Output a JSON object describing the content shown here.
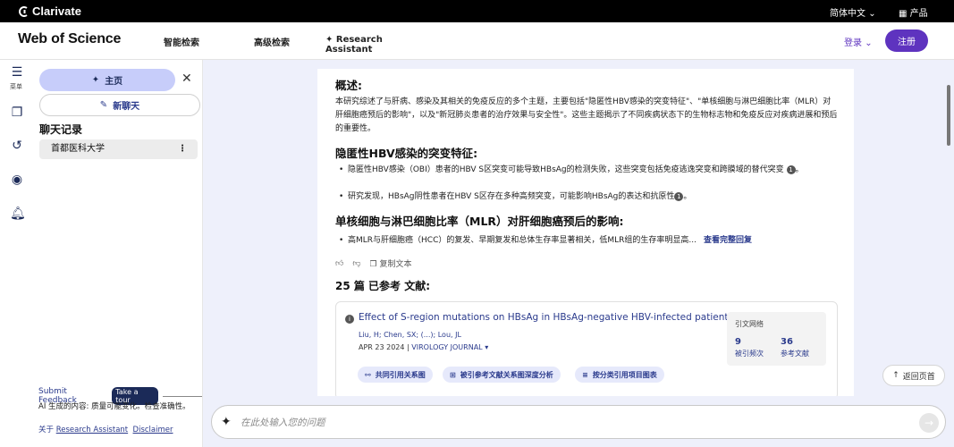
{
  "topbar": {
    "brand": "Clarivate",
    "language": "简体中文",
    "products": "产品"
  },
  "header": {
    "logo": "Web of Science",
    "nav": [
      "智能检索",
      "高级检索",
      "Research Assistant"
    ],
    "login": "登录",
    "register": "注册"
  },
  "rail": {
    "menu_label": "菜单"
  },
  "sidebar": {
    "home": "主页",
    "new_chat": "新聊天",
    "history_title": "聊天记录",
    "history_items": [
      "首都医科大学"
    ],
    "feedback": "Submit Feedback",
    "tour": "Take a tour",
    "ai_note": "AI 生成的内容: 质量可能变化。检查准确性。",
    "about_prefix": "关于 ",
    "about_link": "Research Assistant",
    "disclaimer": "Disclaimer"
  },
  "answer": {
    "overview_heading": "概述:",
    "overview_text": "本研究综述了与肝病、感染及其相关的免疫反应的多个主题，主要包括\"隐匿性HBV感染的突变特征\"、\"单核细胞与淋巴细胞比率（MLR）对肝细胞癌预后的影响\"，以及\"新冠肺炎患者的治疗效果与安全性\"。这些主题揭示了不同疾病状态下的生物标志物和免疫反应对疾病进展和预后的重要性。",
    "section1_heading": "隐匿性HBV感染的突变特征:",
    "section1_bullets": [
      "隐匿性HBV感染（OBI）患者的HBV S区突变可能导致HBsAg的检测失败，这些突变包括免疫逃逸突变和跨膜域的替代突变",
      "研究发现，HBsAg阴性患者在HBV S区存在多种高频突变，可能影响HBsAg的表达和抗原性"
    ],
    "citation_mark": "1",
    "section2_heading": "单核细胞与淋巴细胞比率（MLR）对肝细胞癌预后的影响:",
    "section2_bullet": "高MLR与肝细胞癌（HCC）的复发、早期复发和总体生存率显著相关，低MLR组的生存率明显高...",
    "see_full": "查看完整回复",
    "copy_text": "复制文本",
    "refs_title": "25 篇 已参考 文献:"
  },
  "reference": {
    "title": "Effect of S-region mutations on HBsAg in HBsAg-negative HBV-infected patients",
    "authors": "Liu, H; Chen, SX; (...); Lou, JL",
    "date": "APR 23 2024",
    "journal": "VIROLOGY JOURNAL",
    "network_title": "引文网络",
    "times_cited": "9",
    "times_cited_label": "被引频次",
    "references": "36",
    "references_label": "参考文献",
    "actions": [
      "共同引用关系图",
      "被引参考文献关系图深度分析",
      "按分类引用项目图表"
    ]
  },
  "back_to_top": "返回页首",
  "input": {
    "placeholder": "在此处输入您的问题"
  }
}
